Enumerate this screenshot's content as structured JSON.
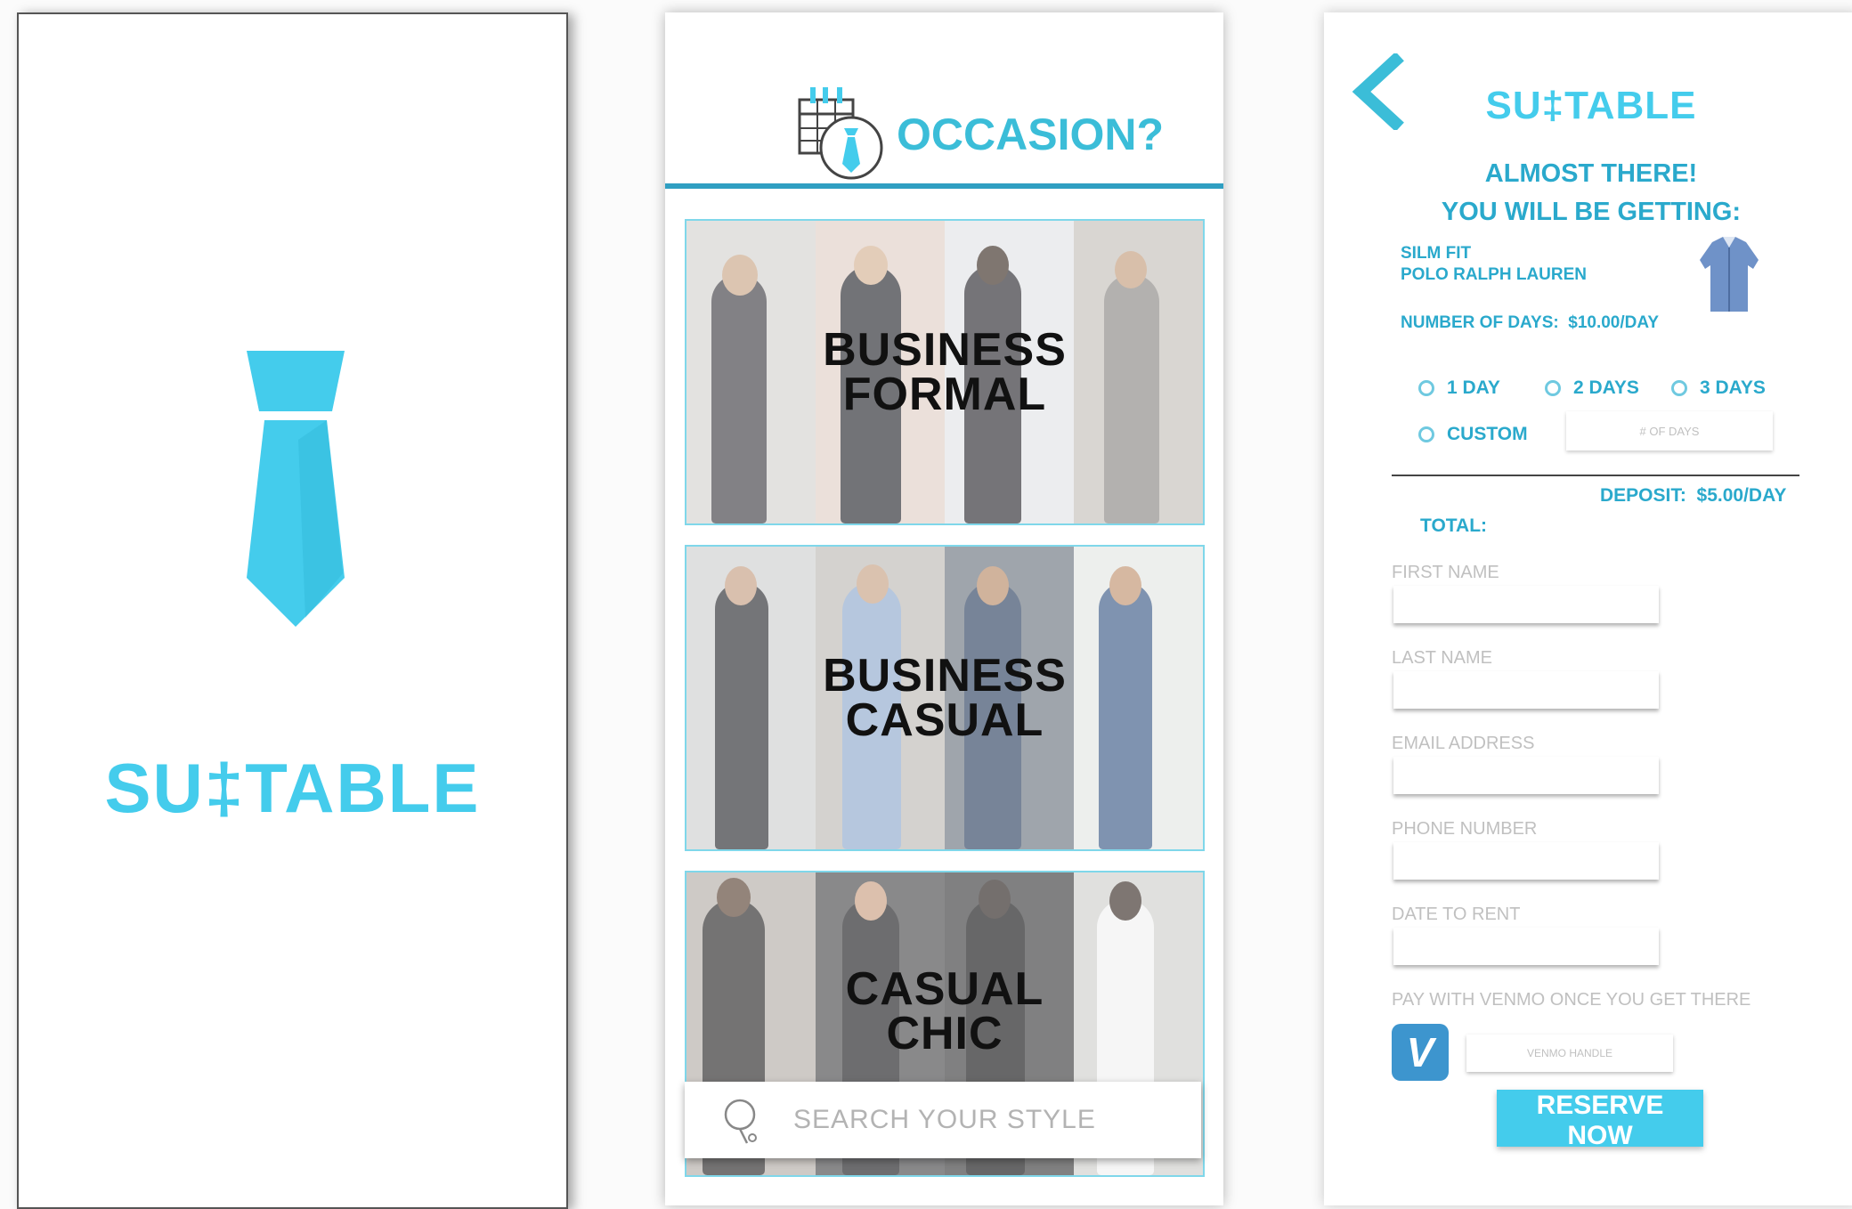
{
  "splash": {
    "brand": "SU‡TABLE",
    "icon": "tie-icon",
    "accent": "#44ccec"
  },
  "occasion": {
    "title": "OCCASION?",
    "icon": "calendar-tie-icon",
    "tiles": [
      {
        "line1": "BUSINESS",
        "line2": "FORMAL"
      },
      {
        "line1": "BUSINESS",
        "line2": "CASUAL"
      },
      {
        "line1": "CASUAL",
        "line2": "CHIC"
      }
    ],
    "search": {
      "placeholder": "SEARCH YOUR STYLE",
      "icon": "search-icon"
    }
  },
  "checkout": {
    "brand": "SU‡TABLE",
    "back_icon": "chevron-left-icon",
    "headline1": "ALMOST THERE!",
    "headline2": "YOU WILL BE GETTING:",
    "item_line1": "SILM FIT",
    "item_line2": "POLO RALPH LAUREN",
    "days_label": "NUMBER OF DAYS:",
    "days_price": "$10.00/DAY",
    "options": [
      "1 DAY",
      "2 DAYS",
      "3 DAYS",
      "CUSTOM"
    ],
    "custom_placeholder": "# OF DAYS",
    "deposit_label": "DEPOSIT:",
    "deposit_value": "$5.00/DAY",
    "total_label": "TOTAL:",
    "fields": [
      "FIRST NAME",
      "LAST NAME",
      "EMAIL ADDRESS",
      "PHONE NUMBER",
      "DATE TO RENT"
    ],
    "venmo_label": "PAY WITH VENMO ONCE YOU GET THERE",
    "venmo_icon": "venmo-icon",
    "venmo_letter": "V",
    "venmo_placeholder": "VENMO HANDLE",
    "reserve_label": "RESERVE NOW",
    "accent": "#44ccec",
    "venmo_color": "#3d95ce"
  }
}
